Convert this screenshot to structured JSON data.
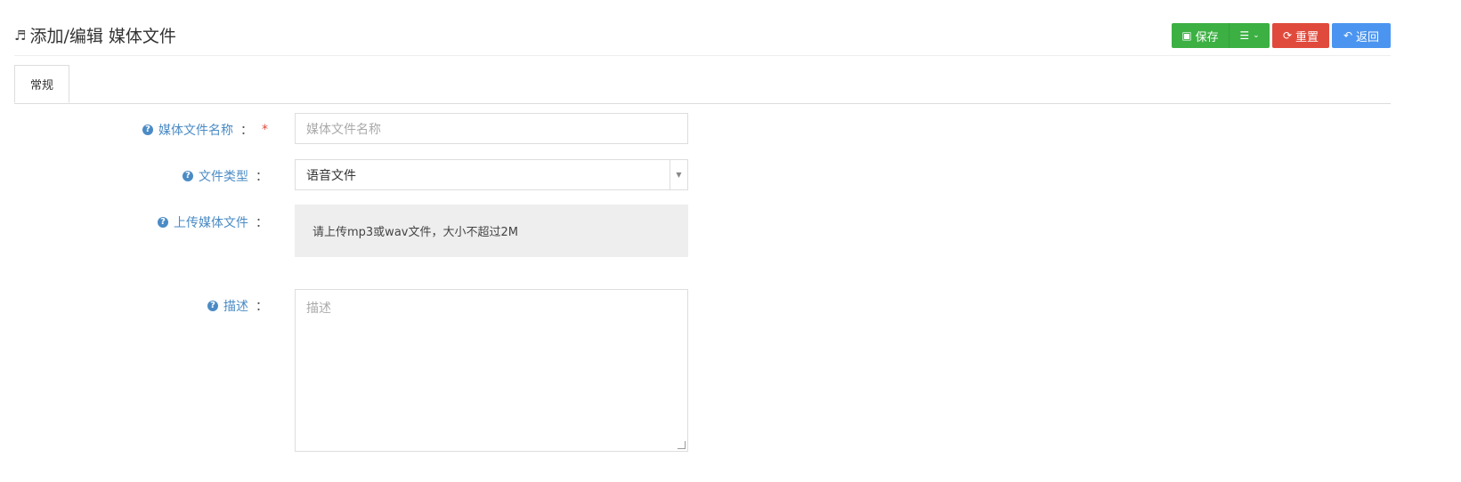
{
  "header": {
    "title": "添加/编辑 媒体文件",
    "icon": "music-note-icon"
  },
  "toolbar": {
    "save_label": "保存",
    "menu_icon": "list-icon",
    "reset_label": "重置",
    "back_label": "返回",
    "colors": {
      "save": "#3cb043",
      "reset": "#e04a3c",
      "back": "#4b95f0"
    }
  },
  "tabs": [
    {
      "label": "常规",
      "active": true
    }
  ],
  "form": {
    "name": {
      "label": "媒体文件名称",
      "colon": "：",
      "required_mark": "*",
      "placeholder": "媒体文件名称",
      "value": ""
    },
    "type": {
      "label": "文件类型",
      "colon": "：",
      "selected": "语音文件"
    },
    "upload": {
      "label": "上传媒体文件",
      "colon": "：",
      "hint": "请上传mp3或wav文件，大小不超过2M"
    },
    "description": {
      "label": "描述",
      "colon": "：",
      "placeholder": "描述",
      "value": ""
    }
  }
}
